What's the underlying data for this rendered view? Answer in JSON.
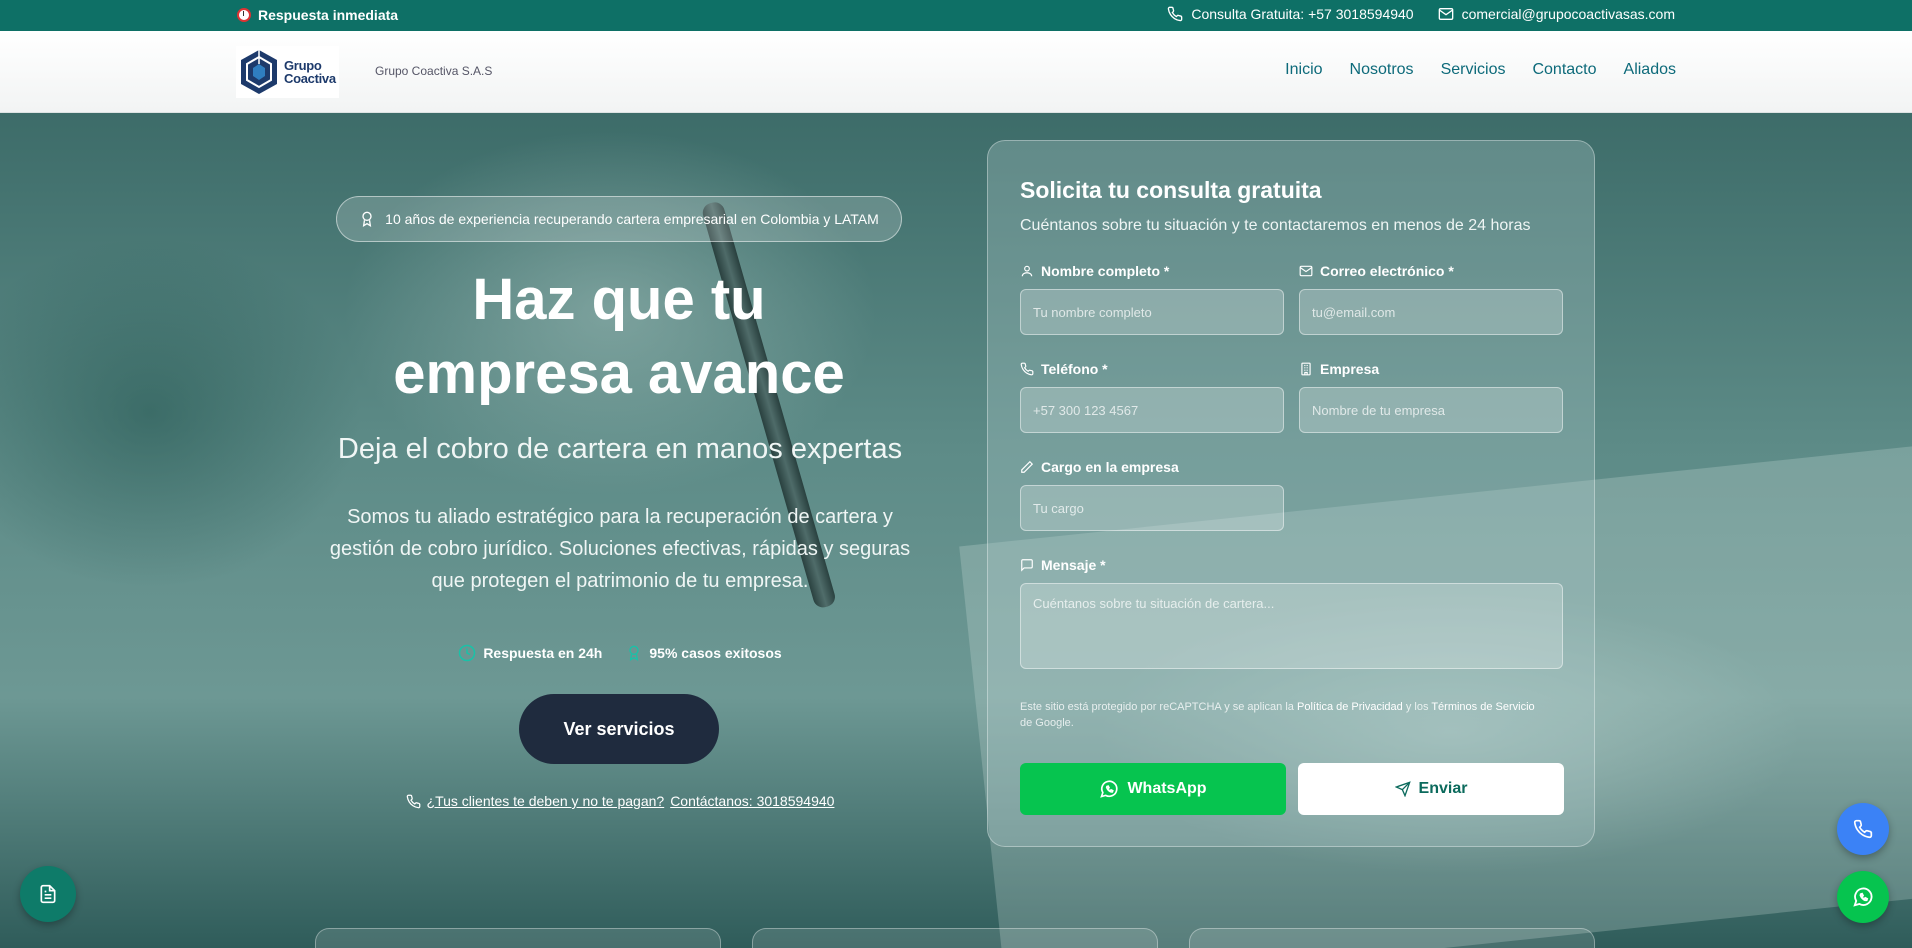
{
  "topbar": {
    "left_label": "Respuesta inmediata",
    "phone_label": "Consulta Gratuita: +57 3018594940",
    "email_label": "comercial@grupocoactivasas.com"
  },
  "header": {
    "logo_text_line1": "Grupo",
    "logo_text_line2": "Coactiva",
    "brand_name": "Grupo Coactiva S.A.S",
    "nav": [
      "Inicio",
      "Nosotros",
      "Servicios",
      "Contacto",
      "Aliados"
    ]
  },
  "hero": {
    "badge": "10 años de experiencia recuperando cartera empresarial en Colombia y LATAM",
    "title_line1": "Haz que tu",
    "title_line2": "empresa avance",
    "subtitle": "Deja el cobro de cartera en manos expertas",
    "description": "Somos tu aliado estratégico para la recuperación de cartera y gestión de cobro jurídico. Soluciones efectivas, rápidas y seguras que protegen el patrimonio de tu empresa.",
    "stats": [
      "Respuesta en 24h",
      "95% casos exitosos"
    ],
    "cta_label": "Ver servicios",
    "phone_question": "¿Tus clientes te deben y no te pagan?",
    "phone_contact": "Contáctanos: 3018594940"
  },
  "form": {
    "title": "Solicita tu consulta gratuita",
    "subtitle": "Cuéntanos sobre tu situación y te contactaremos en menos de 24 horas",
    "name_label": "Nombre completo *",
    "name_placeholder": "Tu nombre completo",
    "email_label": "Correo electrónico *",
    "email_placeholder": "tu@email.com",
    "phone_label": "Teléfono *",
    "phone_placeholder": "+57 300 123 4567",
    "company_label": "Empresa",
    "company_placeholder": "Nombre de tu empresa",
    "role_label": "Cargo en la empresa",
    "role_placeholder": "Tu cargo",
    "message_label": "Mensaje *",
    "message_placeholder": "Cuéntanos sobre tu situación de cartera...",
    "recaptcha_prefix": "Este sitio está protegido por reCAPTCHA y se aplican la",
    "privacy_link": "Política de Privacidad",
    "recaptcha_and": "y los",
    "terms_link": "Términos de Servicio",
    "recaptcha_suffix": "de Google.",
    "whatsapp_label": "WhatsApp",
    "send_label": "Enviar"
  },
  "colors": {
    "topbar": "#0e7066",
    "nav_link": "#0d6a7a",
    "cta": "#1f2b3e",
    "whatsapp": "#06c44f",
    "phone_float": "#3b82f6"
  }
}
